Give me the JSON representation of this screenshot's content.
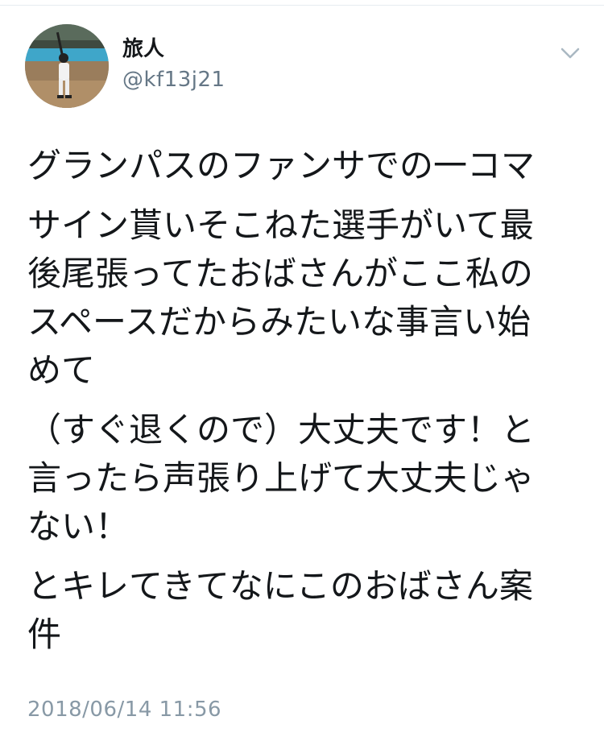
{
  "user": {
    "display_name": "旅人",
    "handle": "@kf13j21",
    "avatar_icon": "avatar-baseball-batter"
  },
  "menu_icon": "chevron-down-icon",
  "tweet": {
    "paragraphs": [
      [
        "グランパスのファンサでの一コマ"
      ],
      [
        "サイン貰いそこねた選手がいて最",
        "後尾張ってたおばさんがここ私の",
        "スペースだからみたいな事言い始",
        "めて"
      ],
      [
        "（すぐ退くので）大丈夫です！と",
        "言ったら声張り上げて大丈夫じゃ",
        "ない！"
      ],
      [
        "とキレてきてなにこのおばさん案",
        "件"
      ]
    ],
    "timestamp": "2018/06/14 11:56"
  },
  "colors": {
    "text": "#14171a",
    "secondary": "#657786",
    "timestamp": "#8899a6",
    "divider": "#e6ecf0"
  }
}
